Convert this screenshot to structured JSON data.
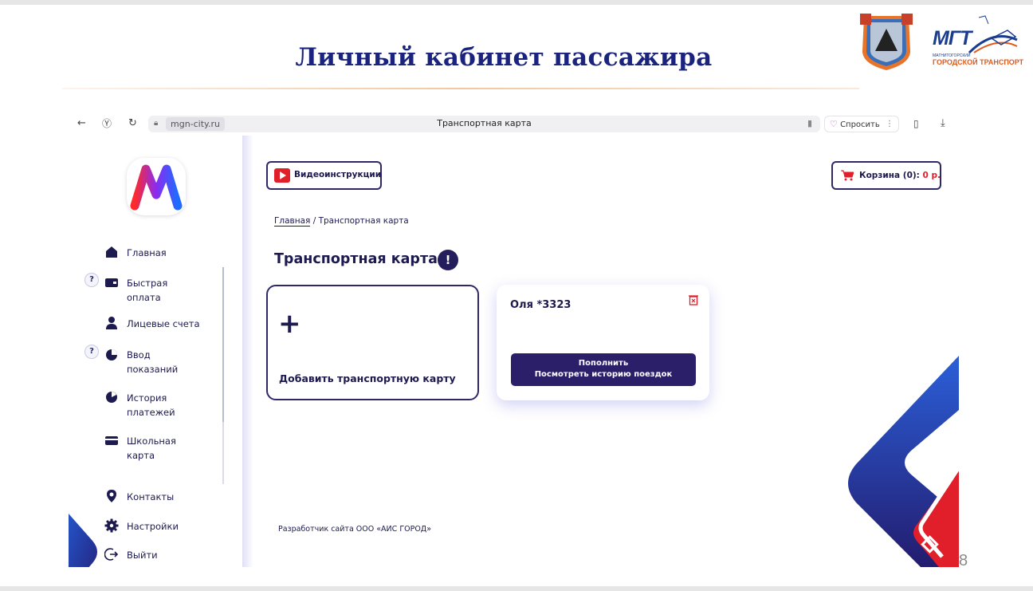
{
  "slide": {
    "title": "Личный кабинет пассажира",
    "page_number": "8",
    "logo": {
      "abbr": "МГТ",
      "line1": "МАГНИТОГОРСКИЙ",
      "line2": "ГОРОДСКОЙ ТРАНСПОРТ"
    }
  },
  "browser": {
    "domain": "mgn-city.ru",
    "tab_title": "Транспортная карта",
    "ask_label": "Спросить"
  },
  "sidebar": {
    "items": [
      {
        "label": "Главная",
        "icon": "home-icon"
      },
      {
        "label": "Быстрая\nоплата",
        "icon": "wallet-icon",
        "help": "?"
      },
      {
        "label": "Лицевые счета",
        "icon": "user-icon"
      },
      {
        "label": "Ввод\nпоказаний",
        "icon": "pie-chart-icon",
        "help": "?"
      },
      {
        "label": "История\nплатежей",
        "icon": "history-chart-icon"
      },
      {
        "label": "Школьная\nкарта",
        "icon": "card-icon"
      },
      {
        "label": "Контакты",
        "icon": "location-pin-icon"
      },
      {
        "label": "Настройки",
        "icon": "gear-icon"
      },
      {
        "label": "Выйти",
        "icon": "logout-icon"
      }
    ]
  },
  "header": {
    "video_label": "Видеоинструкции",
    "cart_label": "Корзина (0): ",
    "cart_price": "0 р."
  },
  "breadcrumb": {
    "home": "Главная",
    "separator": " / ",
    "current": "Транспортная карта"
  },
  "page": {
    "title": "Транспортная карта",
    "info_badge": "!"
  },
  "cards": {
    "add_label": "Добавить транспортную карту",
    "add_symbol": "+",
    "items": [
      {
        "name": "Оля *3323",
        "action_line1": "Пополнить",
        "action_line2": "Посмотреть историю поездок"
      }
    ]
  },
  "footer": {
    "developer": "Разработчик сайта  ООО «АИС ГОРОД»"
  },
  "colors": {
    "primary": "#2e2867",
    "accent_red": "#e01f2a",
    "title_blue": "#1a237e"
  }
}
